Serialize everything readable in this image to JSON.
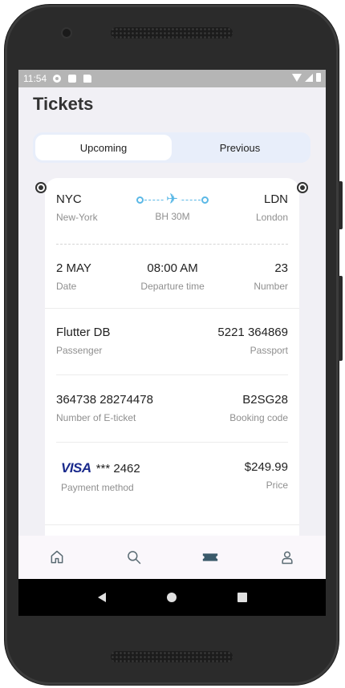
{
  "status_bar": {
    "time": "11:54"
  },
  "page": {
    "title": "Tickets"
  },
  "tabs": [
    {
      "label": "Upcoming",
      "active": true
    },
    {
      "label": "Previous",
      "active": false
    }
  ],
  "ticket": {
    "from_code": "NYC",
    "from_city": "New-York",
    "to_code": "LDN",
    "to_city": "London",
    "duration": "BH 30M",
    "date_value": "2 MAY",
    "date_label": "Date",
    "departure_value": "08:00 AM",
    "departure_label": "Departure time",
    "number_value": "23",
    "number_label": "Number",
    "passenger_value": "Flutter DB",
    "passenger_label": "Passenger",
    "passport_value": "5221 364869",
    "passport_label": "Passport",
    "eticket_value": "364738 28274478",
    "eticket_label": "Number of E-ticket",
    "booking_value": "B2SG28",
    "booking_label": "Booking code",
    "card_brand": "VISA",
    "card_masked": "*** 2462",
    "payment_label": "Payment method",
    "price_value": "$249.99",
    "price_label": "Price"
  },
  "bottom_nav": [
    "home-icon",
    "search-icon",
    "ticket-icon",
    "profile-icon"
  ],
  "colors": {
    "accent": "#5ab8e6",
    "visa": "#1a2a8c",
    "active_nav": "#3a5a6a"
  }
}
